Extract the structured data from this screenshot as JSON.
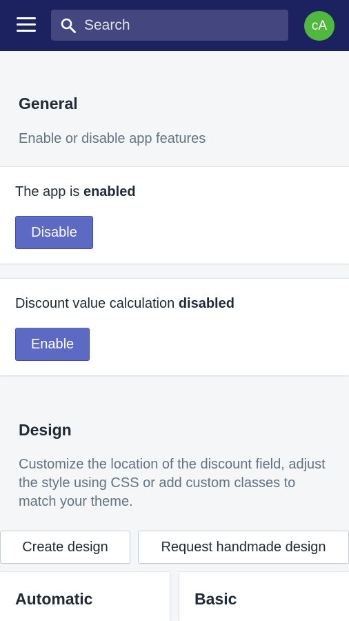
{
  "topbar": {
    "search_placeholder": "Search",
    "avatar_initials": "cA",
    "colors": {
      "bar": "#1c2260",
      "avatar": "#50b83c"
    }
  },
  "general": {
    "title": "General",
    "description": "Enable or disable app features",
    "app_status": {
      "prefix": "The app is",
      "state": "enabled",
      "button_label": "Disable"
    },
    "discount_status": {
      "prefix": "Discount value calculation",
      "state": "disabled",
      "button_label": "Enable"
    }
  },
  "design": {
    "title": "Design",
    "description": "Customize the location of the discount field, adjust the style using CSS or add custom classes to match your theme.",
    "create_button_label": "Create design",
    "request_button_label": "Request handmade design",
    "options": [
      {
        "title": "Automatic"
      },
      {
        "title": "Basic"
      }
    ]
  },
  "colors": {
    "primary": "#5c6ac4"
  }
}
